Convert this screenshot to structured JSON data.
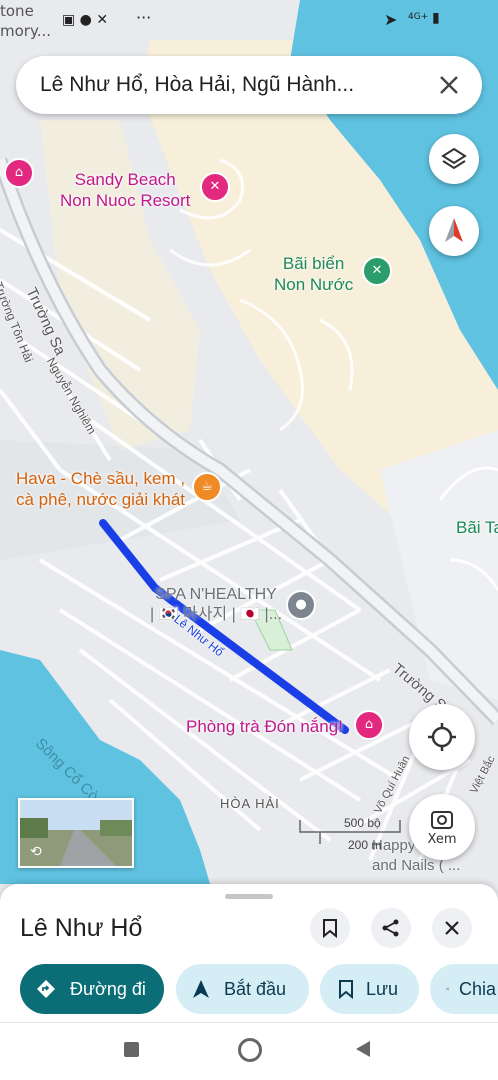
{
  "status": {
    "carrier_fragment_1": "tone",
    "carrier_fragment_2": "mory...",
    "network": "4G+"
  },
  "search": {
    "query": "Lê Như Hổ, Hòa Hải, Ngũ Hành..."
  },
  "map": {
    "pois": {
      "sandy_beach": [
        "Sandy Beach",
        "Non Nuoc Resort"
      ],
      "bai_bien": [
        "Bãi biển",
        "Non Nước"
      ],
      "hava": [
        "Hava - Chè sầu, kem ,",
        "cà phê, nước giải khát"
      ],
      "spa": [
        "SPA N'HEALTHY",
        "| 🇰🇷 마사지 | 🇯🇵 |..."
      ],
      "phong_tra": "Phòng trà Đón nắng!",
      "happy": [
        "Happy ... Mas",
        "and Nails ( ..."
      ],
      "bai_ta": "Bãi Ta"
    },
    "streets": {
      "truong_sa_1": "Trường Sa",
      "truong_sa_2": "Trường Sa",
      "ton_hai": "Trường Tôn Hải",
      "nguyen_nghiem": "Nguyễn Nghiêm",
      "le_nhu_ho": "Lê Như Hổ",
      "vo_qui_huan": "Võ Quí Huân",
      "viet_bac": "Việt Bắc"
    },
    "areas": {
      "hoa_hai": "HÒA HẢI",
      "song": "Sông Cổ Cò"
    },
    "scale": {
      "metric": "500 bộ",
      "secondary": "200 m"
    },
    "lens_label": "Xem"
  },
  "sheet": {
    "title": "Lê Như Hổ",
    "chips": {
      "directions": "Đường đi",
      "start": "Bắt đầu",
      "save": "Lưu",
      "share": "Chia sẻ"
    }
  },
  "colors": {
    "route": "#1a3fe6",
    "primary_chip": "#0b6e76",
    "secondary_chip": "#d5edf5",
    "water": "#5fc2e0",
    "sand": "#f7efd9"
  }
}
